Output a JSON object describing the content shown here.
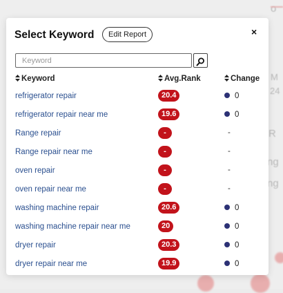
{
  "modal": {
    "title": "Select Keyword",
    "edit_report_label": "Edit Report",
    "close_label": "×"
  },
  "search": {
    "placeholder": "Keyword",
    "value": ""
  },
  "table": {
    "headers": {
      "keyword": "Keyword",
      "avg_rank": "Avg.Rank",
      "change": "Change"
    },
    "rows": [
      {
        "keyword": "refrigerator repair",
        "avg_rank": "20.4",
        "change": "0",
        "has_change": true
      },
      {
        "keyword": "refrigerator repair near me",
        "avg_rank": "19.6",
        "change": "0",
        "has_change": true
      },
      {
        "keyword": "Range repair",
        "avg_rank": "-",
        "change": "-",
        "has_change": false
      },
      {
        "keyword": "Range repair near me",
        "avg_rank": "-",
        "change": "-",
        "has_change": false
      },
      {
        "keyword": "oven repair",
        "avg_rank": "-",
        "change": "-",
        "has_change": false
      },
      {
        "keyword": "oven repair near me",
        "avg_rank": "-",
        "change": "-",
        "has_change": false
      },
      {
        "keyword": "washing machine repair",
        "avg_rank": "20.6",
        "change": "0",
        "has_change": true
      },
      {
        "keyword": "washing machine repair near me",
        "avg_rank": "20",
        "change": "0",
        "has_change": true
      },
      {
        "keyword": "dryer repair",
        "avg_rank": "20.3",
        "change": "0",
        "has_change": true
      },
      {
        "keyword": "dryer repair near me",
        "avg_rank": "19.9",
        "change": "0",
        "has_change": true
      }
    ]
  },
  "colors": {
    "rank_badge": "#c2131b",
    "change_dot": "#2c3175",
    "keyword_link": "#2a4f8f"
  },
  "icons": {
    "search": "search-icon",
    "sort": "sort-icon",
    "close": "close-icon"
  }
}
